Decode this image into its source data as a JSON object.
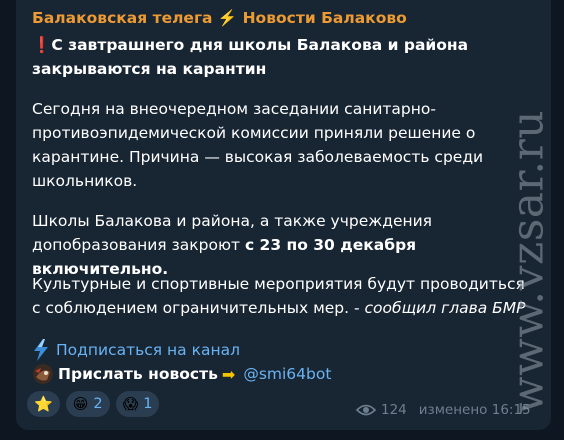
{
  "channel": {
    "name": "Балаковская телега ⚡️ Новости Балаково"
  },
  "post": {
    "headline_icon": "❗",
    "headline": "С завтрашнего дня школы Балакова и района закрываются на карантин",
    "para1": "Сегодня на внеочередном заседании санитарно-противоэпидемической комиссии приняли решение о карантине. Причина — высокая заболеваемость среди школьников.",
    "para2_start": "Школы Балакова и района, а также учреждения допобразования закроют ",
    "para2_bold": "с 23 по 30 декабря включительно.",
    "para3_start": "Культурные и спортивные мероприятия будут проводиться с соблюдением ограничительных мер. - ",
    "para3_italic": "сообщил глава БМР"
  },
  "subscribe": {
    "label": "Подписаться на канал",
    "icon": "lightning-icon"
  },
  "send_news": {
    "label": "Прислать новость",
    "arrow": "➡",
    "bot": "@smi64bot",
    "icon": "mascot-icon"
  },
  "reactions": [
    {
      "emoji": "⭐",
      "count": ""
    },
    {
      "emoji": "😁",
      "count": "2"
    },
    {
      "emoji": "😱",
      "count": "1"
    }
  ],
  "meta": {
    "views": "124",
    "edited": "изменено 16:15"
  },
  "watermark": "www.vzsar.ru",
  "colors": {
    "background": "#0e1621",
    "bubble": "#182533",
    "channel": "#ec9a34",
    "link": "#6ab3f3",
    "meta": "#6d7f8f"
  }
}
